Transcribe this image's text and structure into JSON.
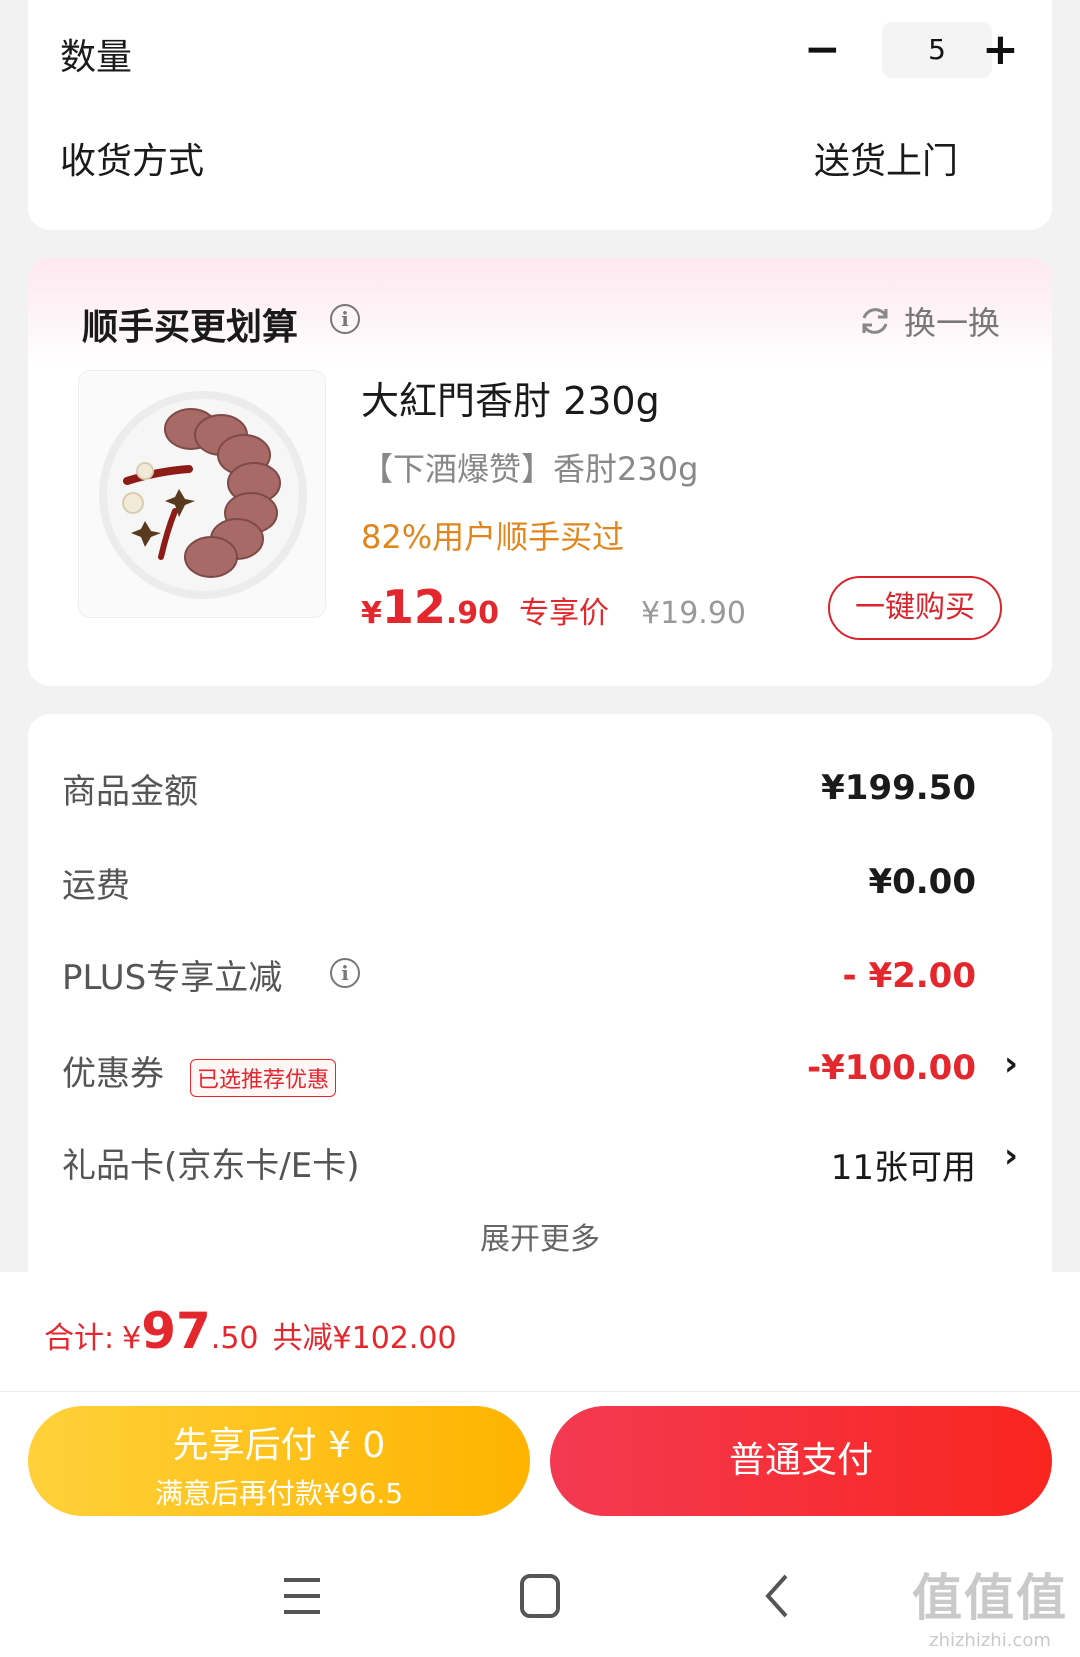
{
  "order_options": {
    "quantity_label": "数量",
    "quantity_value": "5",
    "minus": "−",
    "plus": "+",
    "delivery_label": "收货方式",
    "delivery_value": "送货上门"
  },
  "upsell": {
    "title": "顺手买更划算",
    "info_glyph": "i",
    "refresh_label": "换一换",
    "product": {
      "name": "大紅門香肘 230g",
      "subtitle": "【下酒爆赞】香肘230g",
      "tag": "82%用户顺手买过",
      "price_symbol": "¥",
      "price_int": "12",
      "price_dec": ".90",
      "price_label": "专享价",
      "original_price": "¥19.90",
      "buy_button": "一键购买"
    }
  },
  "summary": {
    "rows": [
      {
        "label": "商品金额",
        "value": "¥199.50"
      },
      {
        "label": "运费",
        "value": "¥0.00"
      },
      {
        "label": "PLUS专享立减",
        "value": "- ¥2.00"
      },
      {
        "label": "优惠券",
        "value": "-¥100.00"
      },
      {
        "label": "礼品卡(京东卡/E卡)",
        "value": "11张可用"
      }
    ],
    "coupon_badge": "已选推荐优惠",
    "chevron": "›",
    "expand_more": "展开更多"
  },
  "total": {
    "label": "合计:",
    "symbol": "¥",
    "int": "97",
    "dec": ".50",
    "saved": "共减¥102.00"
  },
  "payment": {
    "later_line1": "先享后付 ¥ 0",
    "later_line2": "满意后再付款¥96.5",
    "normal": "普通支付"
  },
  "watermark": {
    "big": "值值值",
    "small": "zhizhizhi.com"
  },
  "colors": {
    "accent_red": "#e4262d",
    "accent_orange": "#e1861c",
    "pay_later": "#ffb300",
    "pay_normal": "#f9251f"
  }
}
